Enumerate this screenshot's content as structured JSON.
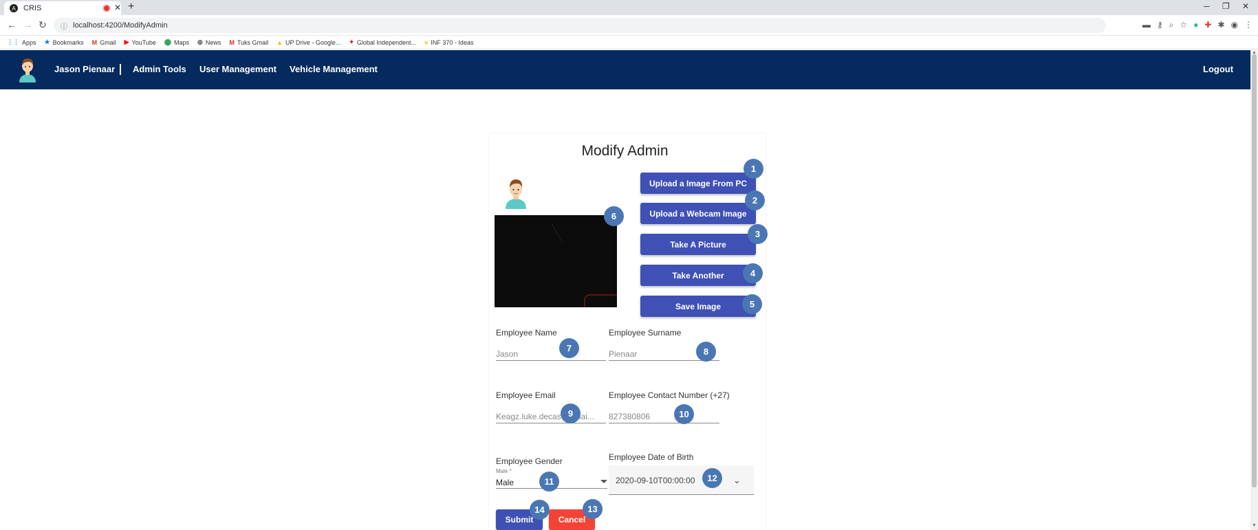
{
  "browser": {
    "tab_title": "CRIS",
    "favicon_letter": "A",
    "close_glyph": "✕",
    "newtab_glyph": "+",
    "window": {
      "minimize": "─",
      "restore": "❐",
      "close": "✕"
    },
    "nav": {
      "back": "←",
      "forward": "→",
      "reload": "↻"
    },
    "url": "localhost:4200/ModifyAdmin",
    "url_info_glyph": "ⓘ",
    "bookmarks": [
      {
        "icon": "⋮⋮",
        "label": "Apps",
        "color": "#4285f4"
      },
      {
        "icon": "★",
        "label": "Bookmarks",
        "color": "#1a73e8"
      },
      {
        "icon": "M",
        "label": "Gmail",
        "color": "#d93025"
      },
      {
        "icon": "▶",
        "label": "YouTube",
        "color": "#ff0000"
      },
      {
        "icon": "⬤",
        "label": "Maps",
        "color": "#34a853"
      },
      {
        "icon": "◍",
        "label": "News",
        "color": "#5f6368"
      },
      {
        "icon": "M",
        "label": "Tuks Gmail",
        "color": "#d93025"
      },
      {
        "icon": "▲",
        "label": "UP Drive - Google...",
        "color": "#fbbc04"
      },
      {
        "icon": "✦",
        "label": "Global Independent...",
        "color": "#c62828"
      },
      {
        "icon": "■",
        "label": "INF 370 - Ideas",
        "color": "#fdd663"
      }
    ]
  },
  "header": {
    "user_name": "Jason Pienaar",
    "nav": [
      "Admin Tools",
      "User Management",
      "Vehicle Management"
    ],
    "logout": "Logout"
  },
  "form": {
    "title": "Modify Admin",
    "buttons": {
      "upload_pc": "Upload a Image From PC",
      "upload_webcam": "Upload a Webcam Image",
      "take_picture": "Take A Picture",
      "take_another": "Take Another",
      "save_image": "Save Image",
      "submit": "Submit",
      "cancel": "Cancel"
    },
    "fields": {
      "name": {
        "label": "Employee Name",
        "placeholder": "Jason"
      },
      "surname": {
        "label": "Employee Surname",
        "placeholder": "Pienaar"
      },
      "email": {
        "label": "Employee Email",
        "placeholder": "Keagz.luke.decas@gmai..."
      },
      "contact": {
        "label": "Employee Contact Number (+27)",
        "placeholder": "827380806"
      },
      "gender": {
        "label": "Employee Gender",
        "float_label": "Male *",
        "value": "Male"
      },
      "dob": {
        "label": "Employee Date of Birth",
        "value": "2020-09-10T00:00:00",
        "arrow": "⌄"
      }
    }
  },
  "markers": [
    "1",
    "2",
    "3",
    "4",
    "5",
    "6",
    "7",
    "8",
    "9",
    "10",
    "11",
    "12",
    "13",
    "14"
  ],
  "colors": {
    "appbar": "#042a5e",
    "primary": "#3f51b5",
    "warn": "#f44336",
    "marker": "#4a77b4"
  }
}
